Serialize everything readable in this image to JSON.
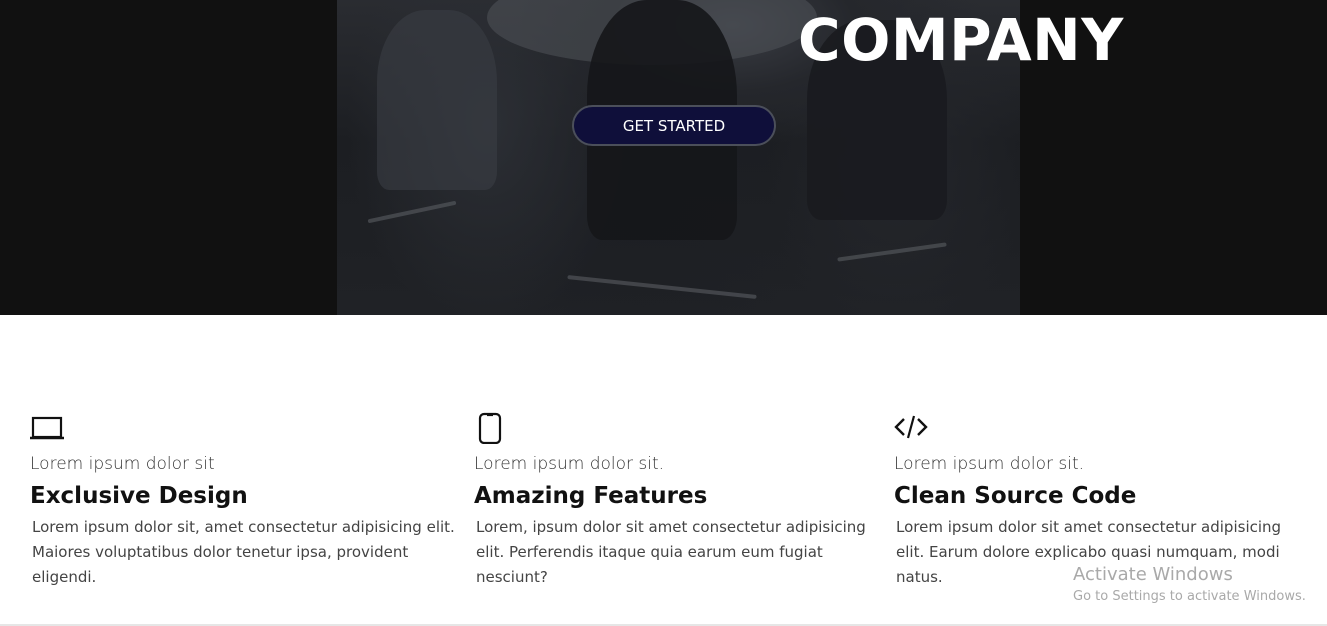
{
  "hero": {
    "title": "COMPANY",
    "cta_label": "GET STARTED",
    "cta_color": "#0f0f3a",
    "background_color": "#111111"
  },
  "features": [
    {
      "icon": "laptop-icon",
      "kicker": "Lorem ipsum dolor sit",
      "title": "Exclusive Design",
      "description": "Lorem ipsum dolor sit, amet consectetur adipisicing elit. Maiores voluptatibus dolor tenetur ipsa, provident eligendi."
    },
    {
      "icon": "mobile-phone-icon",
      "kicker": "Lorem ipsum dolor sit.",
      "title": "Amazing Features",
      "description": "Lorem, ipsum dolor sit amet consectetur adipisicing elit. Perferendis itaque quia earum eum fugiat nesciunt?"
    },
    {
      "icon": "code-icon",
      "kicker": "Lorem ipsum dolor sit.",
      "title": "Clean Source Code",
      "description": "Lorem ipsum dolor sit amet consectetur adipisicing elit. Earum dolore explicabo quasi numquam, modi natus."
    }
  ],
  "watermark": {
    "title": "Activate Windows",
    "subtitle": "Go to Settings to activate Windows."
  }
}
